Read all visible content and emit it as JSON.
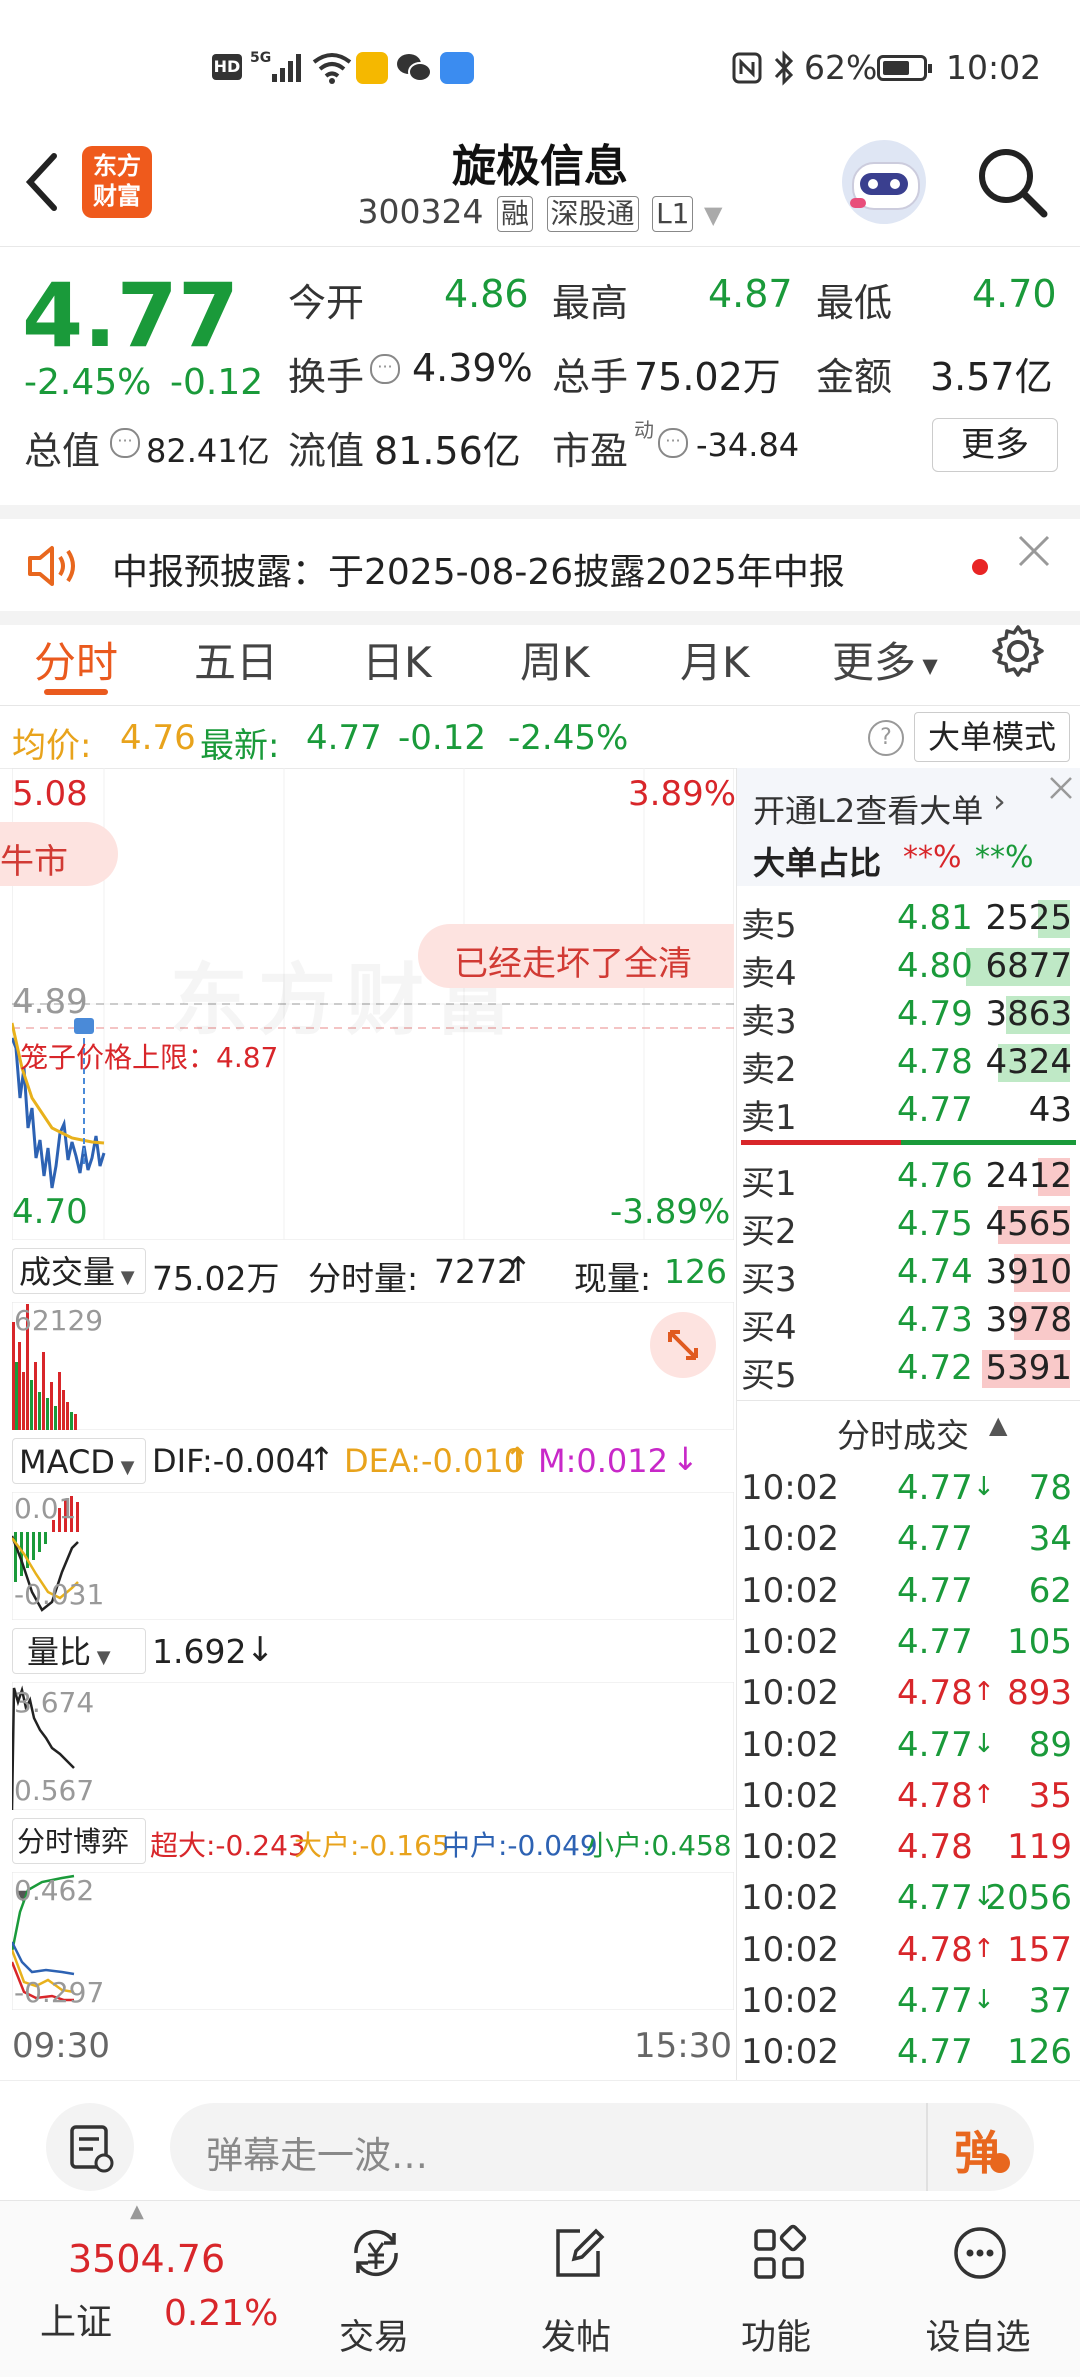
{
  "status_bar": {
    "time": "10:02",
    "battery": "62%",
    "left_icons": [
      "hd-icon",
      "5g-signal-icon",
      "wifi-icon",
      "wallet-app-icon",
      "wechat-icon",
      "cloud-icon"
    ],
    "network": "5G",
    "hd": "HD"
  },
  "header": {
    "app_logo": "东方\n财富",
    "logo_line1": "东方",
    "logo_line2": "财富",
    "stock_name": "旋极信息",
    "stock_code": "300324",
    "tags": [
      "融",
      "深股通",
      "L1"
    ]
  },
  "quote": {
    "price": "4.77",
    "change_pct": "-2.45%",
    "change": "-0.12",
    "open_label": "今开",
    "open": "4.86",
    "high_label": "最高",
    "high": "4.87",
    "low_label": "最低",
    "low": "4.70",
    "turnover_label": "换手",
    "turnover": "4.39%",
    "volume_label": "总手",
    "volume": "75.02万",
    "amount_label": "金额",
    "amount": "3.57亿",
    "mktcap_label": "总值",
    "mktcap": "82.41亿",
    "float_label": "流值",
    "float_cap": "81.56亿",
    "pe_label": "市盈",
    "pe_sup": "动",
    "pe": "-34.84",
    "more_button": "更多"
  },
  "notice": {
    "text": "中报预披露：于2025-08-26披露2025年中报"
  },
  "tabs": {
    "items": [
      "分时",
      "五日",
      "日K",
      "周K",
      "月K",
      "更多"
    ],
    "active": 0
  },
  "info_line": {
    "avg_label": "均价:",
    "avg": "4.76",
    "latest_label": "最新:",
    "latest": "4.77",
    "change": "-0.12",
    "change_pct": "-2.45%",
    "big_order_mode": "大单模式"
  },
  "chart": {
    "top_price": "5.08",
    "top_pct": "3.89%",
    "bottom_price": "4.70",
    "bottom_pct": "-3.89%",
    "ref_price": "4.89",
    "limit_label": "笼子价格上限：4.87",
    "danmaku_1": "牛市",
    "danmaku_2": "已经走坏了全清",
    "time_start": "09:30",
    "time_end": "15:30",
    "watermark": "东方财富"
  },
  "volume_panel": {
    "selector": "成交量",
    "total": "75.02万",
    "minute_vol_label": "分时量:",
    "minute_vol": "7272",
    "current_vol_label": "现量:",
    "current_vol": "126",
    "axis_max": "62129"
  },
  "macd_panel": {
    "selector": "MACD",
    "dif": "DIF:-0.004",
    "dea": "DEA:-0.010",
    "m": "M:0.012",
    "axis_top": "0.01",
    "axis_bottom": "-0.031"
  },
  "volume_ratio_panel": {
    "selector": "量比",
    "value": "1.692",
    "axis_top": "3.674",
    "axis_bottom": "0.567"
  },
  "game_panel": {
    "selector": "分时博弈",
    "super": "超大:-0.243",
    "large": "大户:-0.165",
    "medium": "中户:-0.049",
    "small": "小户:0.458",
    "axis_top": "0.462",
    "axis_bottom": "-0.297"
  },
  "order_book": {
    "l2_link": "开通L2查看大单",
    "ratio_label": "大单占比",
    "ratio_sell": "**%",
    "ratio_buy": "**%",
    "sell": [
      {
        "label": "卖5",
        "price": "4.81",
        "vol": "2525",
        "bar": 0.2
      },
      {
        "label": "卖4",
        "price": "4.80",
        "vol": "6877",
        "bar": 0.65
      },
      {
        "label": "卖3",
        "price": "4.79",
        "vol": "3863",
        "bar": 0.4
      },
      {
        "label": "卖2",
        "price": "4.78",
        "vol": "4324",
        "bar": 0.45
      },
      {
        "label": "卖1",
        "price": "4.77",
        "vol": "43",
        "bar": 0
      }
    ],
    "buy": [
      {
        "label": "买1",
        "price": "4.76",
        "vol": "2412",
        "bar": 0.2
      },
      {
        "label": "买2",
        "price": "4.75",
        "vol": "4565",
        "bar": 0.45
      },
      {
        "label": "买3",
        "price": "4.74",
        "vol": "3910",
        "bar": 0.35
      },
      {
        "label": "买4",
        "price": "4.73",
        "vol": "3978",
        "bar": 0.35
      },
      {
        "label": "买5",
        "price": "4.72",
        "vol": "5391",
        "bar": 0.55
      }
    ]
  },
  "trades": {
    "title": "分时成交",
    "rows": [
      {
        "time": "10:02",
        "price": "4.77",
        "dir": "down",
        "vol": "78",
        "vol_color": "green"
      },
      {
        "time": "10:02",
        "price": "4.77",
        "dir": "",
        "vol": "34",
        "vol_color": "green"
      },
      {
        "time": "10:02",
        "price": "4.77",
        "dir": "",
        "vol": "62",
        "vol_color": "green"
      },
      {
        "time": "10:02",
        "price": "4.77",
        "dir": "",
        "vol": "105",
        "vol_color": "green"
      },
      {
        "time": "10:02",
        "price": "4.78",
        "dir": "up",
        "vol": "893",
        "vol_color": "red"
      },
      {
        "time": "10:02",
        "price": "4.77",
        "dir": "down",
        "vol": "89",
        "vol_color": "green"
      },
      {
        "time": "10:02",
        "price": "4.78",
        "dir": "up",
        "vol": "35",
        "vol_color": "red"
      },
      {
        "time": "10:02",
        "price": "4.78",
        "dir": "",
        "vol": "119",
        "vol_color": "red"
      },
      {
        "time": "10:02",
        "price": "4.77",
        "dir": "down",
        "vol": "2056",
        "vol_color": "green"
      },
      {
        "time": "10:02",
        "price": "4.78",
        "dir": "up",
        "vol": "157",
        "vol_color": "red"
      },
      {
        "time": "10:02",
        "price": "4.77",
        "dir": "down",
        "vol": "37",
        "vol_color": "green"
      },
      {
        "time": "10:02",
        "price": "4.77",
        "dir": "",
        "vol": "126",
        "vol_color": "green"
      }
    ]
  },
  "comment_bar": {
    "placeholder": "弹幕走一波…",
    "danmaku_button": "弹"
  },
  "bottom_nav": {
    "index_value": "3504.76",
    "index_name": "上证",
    "index_change": "0.21%",
    "items": [
      "交易",
      "发帖",
      "功能",
      "设自选"
    ]
  }
}
